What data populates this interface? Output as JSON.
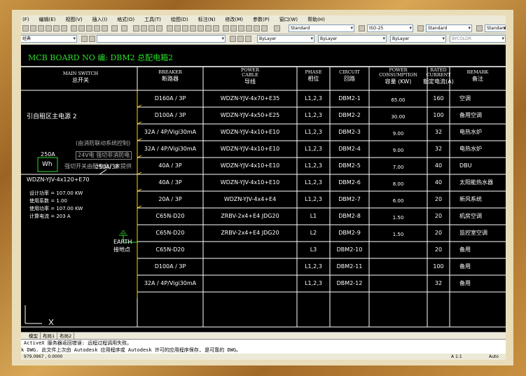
{
  "menu": [
    "(F)",
    "编辑(E)",
    "视图(V)",
    "插入(I)",
    "格式(O)",
    "工具(T)",
    "绘图(D)",
    "标注(N)",
    "修改(M)",
    "参数(P)",
    "窗口(W)",
    "帮助(H)"
  ],
  "toolbar": {
    "text_style": "Standard",
    "dim_style": "ISO-25",
    "table_style": "Standard",
    "multileader_style": "Standard",
    "workspace": "经典",
    "color": "ByLayer",
    "linetype": "ByLayer",
    "lineweight": "ByLayer",
    "plotstyle": "BYCOLOR"
  },
  "drawing": {
    "title": "MCB BOARD NO 编: DBM2 总配电箱2",
    "headers": {
      "main_en": "MAIN SWITCH",
      "main_cn": "总开关",
      "breaker_en": "BREAKER",
      "breaker_cn": "断路器",
      "cable_en1": "POWER",
      "cable_en2": "CABLE",
      "cable_cn": "导线",
      "phase_en": "PHASE",
      "phase_cn": "相位",
      "circuit_en": "CIRCUIT",
      "circuit_cn": "回路",
      "cons_en1": "POWER",
      "cons_en2": "CONSUMPTION",
      "cons_cn": "容量 (KW)",
      "rated_en1": "RATED",
      "rated_en2": "CURRENT",
      "rated_cn": "额定电流(A)",
      "remark_en": "REMARK",
      "remark_cn": "备注"
    },
    "main": {
      "source": "引自租区主电源 2",
      "fire_ctrl": "(由消防联动系统控制)",
      "fire_24v": "24V电 强切非消防电",
      "fire_note": "强切开关由配电商厂家提供",
      "meter_rating": "250A",
      "meter_label": "Wh",
      "main_breaker": "250A/3P",
      "incoming_cable": "WDZN-YJV-4x120+E70",
      "calc1": "设计功率 = 107.00 KW",
      "calc2": "使用系数 = 1.00",
      "calc3": "使用功率 = 107.00  KW",
      "calc4": "计算电流 = 203 A",
      "earth_en": "EARTH",
      "earth_cn": "接地点"
    },
    "rows": [
      {
        "breaker": "D160A / 3P",
        "cable": "WDZN-YJV-4x70+E35",
        "phase": "L1,2,3",
        "circuit": "DBM2-1",
        "power": "65.00",
        "current": "160",
        "remark": "空调"
      },
      {
        "breaker": "D100A / 3P",
        "cable": "WDZN-YJV-4x50+E25",
        "phase": "L1,2,3",
        "circuit": "DBM2-2",
        "power": "30.00",
        "current": "100",
        "remark": "备用空调"
      },
      {
        "breaker": "32A / 4P/Vigi30mA",
        "cable": "WDZN-YJV-4x10+E10",
        "phase": "L1,2,3",
        "circuit": "DBM2-3",
        "power": "9.00",
        "current": "32",
        "remark": "电热水炉"
      },
      {
        "breaker": "32A / 4P/Vigi30mA",
        "cable": "WDZN-YJV-4x10+E10",
        "phase": "L1,2,3",
        "circuit": "DBM2-4",
        "power": "9.00",
        "current": "32",
        "remark": "电热水炉"
      },
      {
        "breaker": "40A / 3P",
        "cable": "WDZN-YJV-4x10+E10",
        "phase": "L1,2,3",
        "circuit": "DBM2-5",
        "power": "7.00",
        "current": "40",
        "remark": "DBU"
      },
      {
        "breaker": "40A / 3P",
        "cable": "WDZN-YJV-4x10+E10",
        "phase": "L1,2,3",
        "circuit": "DBM2-6",
        "power": "8.00",
        "current": "40",
        "remark": "太阳能热水器"
      },
      {
        "breaker": "20A / 3P",
        "cable": "WDZN-YJV-4x4+E4",
        "phase": "L1,2,3",
        "circuit": "DBM2-7",
        "power": "6.00",
        "current": "20",
        "remark": "新风系统"
      },
      {
        "breaker": "C65N-D20",
        "cable": "ZRBV-2x4+E4 JDG20",
        "phase": "L1",
        "circuit": "DBM2-8",
        "power": "1.50",
        "current": "20",
        "remark": "机房空调"
      },
      {
        "breaker": "C65N-D20",
        "cable": "ZRBV-2x4+E4 JDG20",
        "phase": "L2",
        "circuit": "DBM2-9",
        "power": "1.50",
        "current": "20",
        "remark": "监控室空调"
      },
      {
        "breaker": "C65N-D20",
        "cable": "",
        "phase": "L3",
        "circuit": "DBM2-10",
        "power": "",
        "current": "20",
        "remark": "备用"
      },
      {
        "breaker": "D100A / 3P",
        "cable": "",
        "phase": "L1,2,3",
        "circuit": "DBM2-11",
        "power": "",
        "current": "100",
        "remark": "备用"
      },
      {
        "breaker": "32A / 4P/Vigi30mA",
        "cable": "",
        "phase": "L1,2,3",
        "circuit": "DBM2-12",
        "power": "",
        "current": "32",
        "remark": "备用"
      }
    ]
  },
  "tabs": [
    "模型",
    "布局1",
    "布局2"
  ],
  "command": {
    "line1": "ActiveX 服务器返回错误: 远程过程调用失败。",
    "line2": "此文件上次由 Autodesk 应用程序或 Autodesk 许可的应用程序保存, 是可靠的 DWG。",
    "line2_prefix": "k DWG."
  },
  "status": {
    "coords": "979.0967 , 0.0000",
    "scale": "A 1:1",
    "auto": "Auto"
  }
}
